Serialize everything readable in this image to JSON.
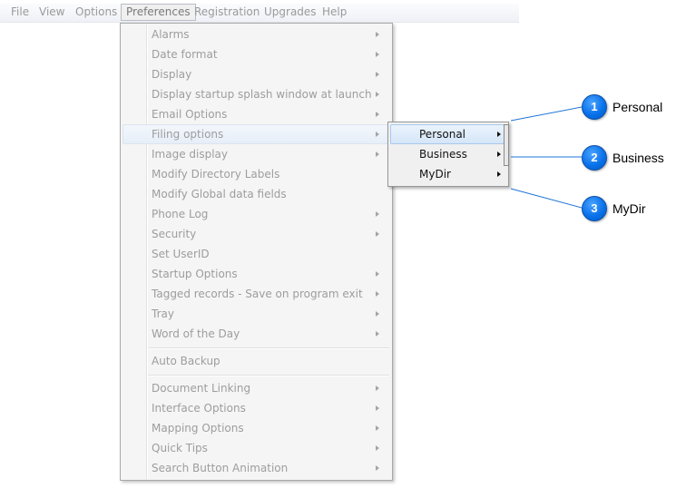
{
  "menubar": {
    "items": [
      "File",
      "View",
      "Options",
      "Preferences",
      "Registration",
      "Upgrades",
      "Help"
    ],
    "active": "Preferences"
  },
  "preferences_menu": {
    "items": [
      {
        "label": "Alarms",
        "submenu": true
      },
      {
        "label": "Date format",
        "submenu": true
      },
      {
        "label": "Display",
        "submenu": true
      },
      {
        "label": "Display startup splash window at launch",
        "submenu": true
      },
      {
        "label": "Email Options",
        "submenu": true
      },
      {
        "label": "Filing options",
        "submenu": true,
        "hover": true
      },
      {
        "label": "Image display",
        "submenu": true
      },
      {
        "label": "Modify Directory Labels",
        "submenu": false
      },
      {
        "label": "Modify Global data fields",
        "submenu": false
      },
      {
        "label": "Phone Log",
        "submenu": true
      },
      {
        "label": "Security",
        "submenu": true
      },
      {
        "label": "Set UserID",
        "submenu": false
      },
      {
        "label": "Startup Options",
        "submenu": true
      },
      {
        "label": "Tagged records - Save on program exit",
        "submenu": true
      },
      {
        "label": "Tray",
        "submenu": true
      },
      {
        "label": "Word of the Day",
        "submenu": true
      },
      {
        "label": "Auto Backup",
        "submenu": false
      },
      {
        "label": "Document Linking",
        "submenu": true
      },
      {
        "label": "Interface Options",
        "submenu": true
      },
      {
        "label": "Mapping Options",
        "submenu": true
      },
      {
        "label": "Quick Tips",
        "submenu": true
      },
      {
        "label": "Search Button Animation",
        "submenu": true
      }
    ]
  },
  "filing_submenu": {
    "items": [
      {
        "label": "Personal",
        "selected": true
      },
      {
        "label": "Business",
        "selected": false
      },
      {
        "label": "MyDir",
        "selected": false
      }
    ]
  },
  "callouts": [
    {
      "number": "1",
      "label": "Personal"
    },
    {
      "number": "2",
      "label": "Business"
    },
    {
      "number": "3",
      "label": "MyDir"
    }
  ],
  "colors": {
    "callout_blue": "#0a72ea",
    "leader_line": "#1e73d6",
    "disabled_text": "#9d9d9d"
  }
}
